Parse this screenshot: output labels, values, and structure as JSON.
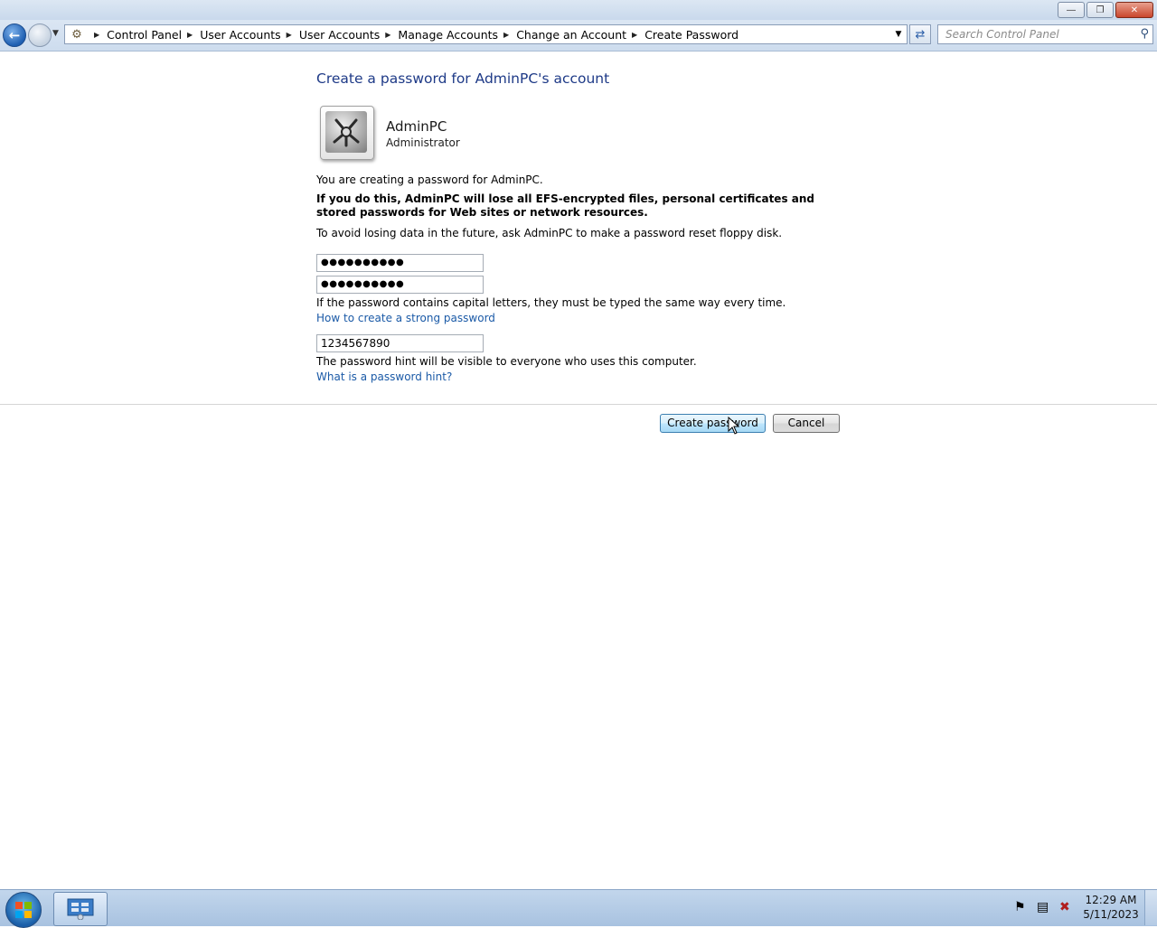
{
  "window": {
    "minimize_label": "―",
    "maximize_label": "❐",
    "close_label": "✕"
  },
  "nav": {
    "breadcrumb": [
      "Control Panel",
      "User Accounts",
      "User Accounts",
      "Manage Accounts",
      "Change an Account",
      "Create Password"
    ],
    "search_placeholder": "Search Control Panel"
  },
  "main": {
    "heading": "Create a password for AdminPC's account",
    "account_name": "AdminPC",
    "account_type": "Administrator",
    "info_text": "You are creating a password for AdminPC.",
    "warning_text": "If you do this, AdminPC will lose all EFS-encrypted files, personal certificates and stored passwords for Web sites or network resources.",
    "advice_text": "To avoid losing data in the future, ask AdminPC to make a password reset floppy disk.",
    "new_password_value": "●●●●●●●●●●",
    "confirm_password_value": "●●●●●●●●●●",
    "caps_note": "If the password contains capital letters, they must be typed the same way every time.",
    "strong_password_link": "How to create a strong password",
    "hint_value": "1234567890",
    "hint_note": "The password hint will be visible to everyone who uses this computer.",
    "hint_link": "What is a password hint?"
  },
  "actions": {
    "create_label": "Create password",
    "cancel_label": "Cancel"
  },
  "taskbar": {
    "time": "12:29 AM",
    "date": "5/11/2023"
  },
  "icons": [
    "back-icon",
    "forward-icon",
    "control-panel-icon",
    "refresh-icon",
    "search-icon",
    "user-tile-icon",
    "start-orb-icon",
    "flag-icon",
    "network-icon",
    "volume-muted-icon",
    "mouse-cursor-icon"
  ]
}
